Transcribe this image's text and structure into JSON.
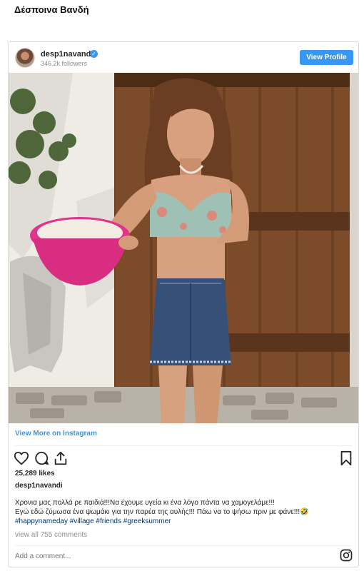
{
  "page": {
    "title": "Δέσποινα Βανδή"
  },
  "post": {
    "username": "desp1navandi",
    "verified_icon": "verified-badge-icon",
    "followers": "346.2k followers",
    "view_profile_label": "View Profile",
    "view_more_label": "View More on Instagram",
    "likes": "25,289 likes",
    "caption_user": "desp1navandi",
    "caption_line1": "Χρονια μας πολλά ρε παιδιά!!!Να έχουμε υγεία κι ένα λόγο πάντα να χαμογελάμε!!!",
    "caption_line2": "Εγώ εδώ ζύμωσα ένα ψωμάκι για την παρέα της αυλής!!! Πάω να το ψήσω πριν με φάνε!!!🤣",
    "hashtags": "#happynameday #village #friends #greeksummer",
    "view_comments": "view all 755 comments",
    "comment_placeholder": "Add a comment...",
    "icons": {
      "like": "heart-icon",
      "comment": "comment-bubble-icon",
      "share": "share-icon",
      "save": "bookmark-icon",
      "logo": "instagram-logo-icon"
    },
    "colors": {
      "accent": "#3897f0",
      "hashtag": "#003569",
      "muted": "#8e8e8e"
    }
  }
}
